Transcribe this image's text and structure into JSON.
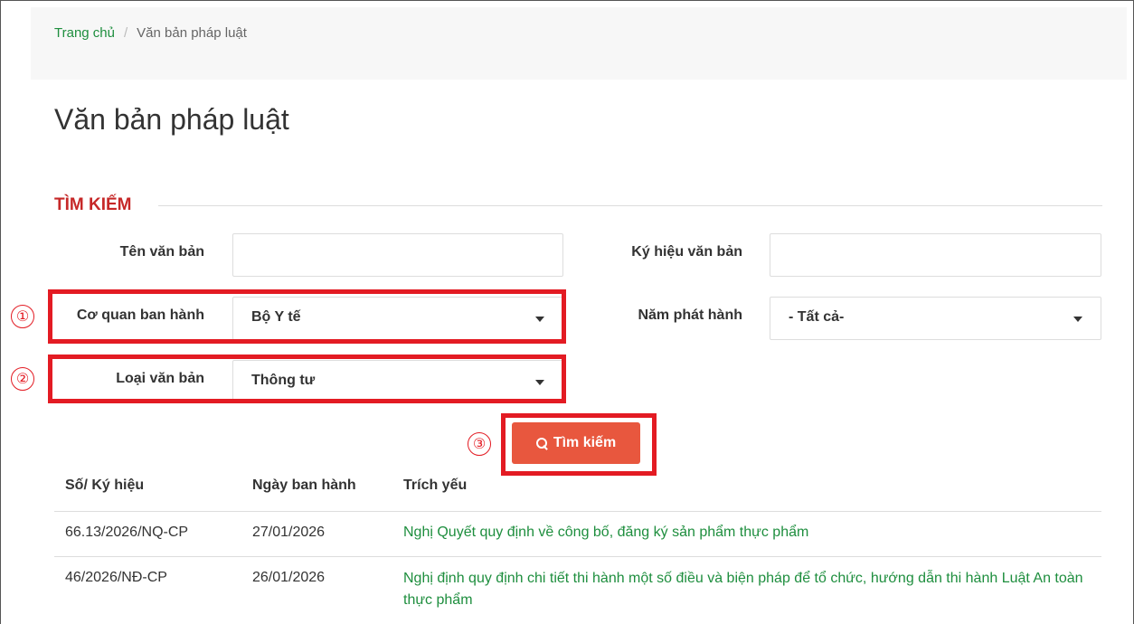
{
  "breadcrumb": {
    "home": "Trang chủ",
    "separator": "/",
    "current": "Văn bản pháp luật"
  },
  "page_title": "Văn bản pháp luật",
  "search": {
    "section_title": "TÌM KIẾM",
    "name_label": "Tên văn bản",
    "name_value": "",
    "code_label": "Ký hiệu văn bản",
    "code_value": "",
    "agency_label": "Cơ quan ban hành",
    "agency_value": "Bộ Y tế",
    "year_label": "Năm phát hành",
    "year_value": "- Tất cả-",
    "type_label": "Loại văn bản",
    "type_value": "Thông tư",
    "button_label": "Tìm kiếm"
  },
  "annotations": [
    "①",
    "②",
    "③"
  ],
  "table": {
    "headers": [
      "Số/ Ký hiệu",
      "Ngày ban hành",
      "Trích yếu"
    ],
    "rows": [
      {
        "code": "66.13/2026/NQ-CP",
        "date": "27/01/2026",
        "summary": "Nghị Quyết quy định về công bố, đăng ký sản phẩm thực phẩm"
      },
      {
        "code": "46/2026/NĐ-CP",
        "date": "26/01/2026",
        "summary": "Nghị định quy định chi tiết thi hành một số điều và biện pháp để tổ chức, hướng dẫn thi hành Luật An toàn thực phẩm"
      }
    ]
  },
  "colors": {
    "accent_red": "#e31b23",
    "link_green": "#1e8e3e",
    "button": "#e8573e"
  }
}
